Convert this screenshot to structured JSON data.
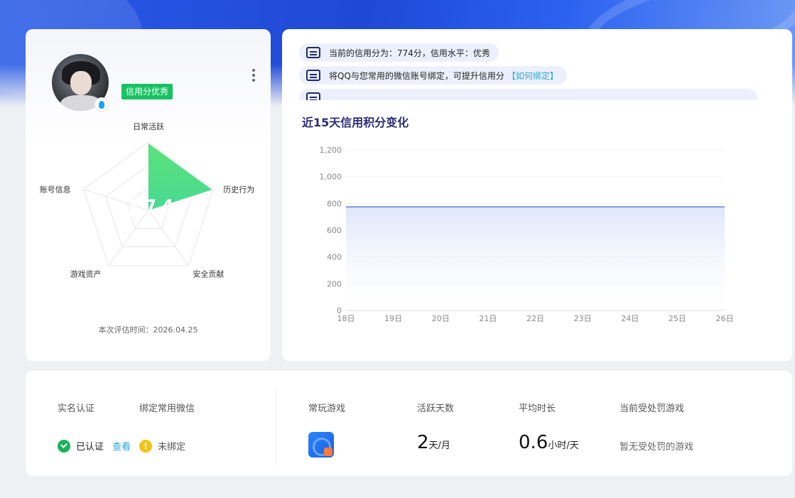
{
  "profile": {
    "credit_badge": "信用分优秀",
    "score": "774",
    "eval_time": "本次评估时间：2026.04.25",
    "radar_axes": [
      "日常活跃",
      "历史行为",
      "安全贡献",
      "游戏资产",
      "账号信息"
    ],
    "radar_values": [
      0.98,
      0.98,
      0.0,
      0.98,
      0.0
    ],
    "radar_fill_color": "#3fdc8a"
  },
  "tips": [
    {
      "text": "当前的信用分为：774分，信用水平：优秀",
      "link": ""
    },
    {
      "text": "将QQ与您常用的微信账号绑定，可提升信用分",
      "link": "【如何绑定】"
    }
  ],
  "chart_title": "近15天信用积分变化",
  "chart_data": {
    "type": "area",
    "x": [
      "18日",
      "19日",
      "20日",
      "21日",
      "22日",
      "23日",
      "24日",
      "25日",
      "26日"
    ],
    "series": [
      {
        "values": [
          774,
          774,
          774,
          774,
          774,
          774,
          774,
          774,
          774
        ]
      }
    ],
    "yticks": [
      "0",
      "200",
      "400",
      "600",
      "800",
      "1,000",
      "1,200"
    ],
    "ylim": [
      0,
      1200
    ],
    "grid": true,
    "line_color": "#7a9ad8",
    "fill_color": "#dfe6fb"
  },
  "info": {
    "realname_label": "实名认证",
    "wechat_label": "绑定常用微信",
    "realname_status": "已认证",
    "view_link": "查看",
    "wechat_status": "未绑定",
    "games_label": "常玩游戏",
    "active_days_label": "活跃天数",
    "avg_time_label": "平均时长",
    "punish_label": "当前受处罚游戏",
    "active_days_value": "2",
    "active_days_unit": "天/月",
    "avg_time_value": "0.6",
    "avg_time_unit": "小时/天",
    "punish_text": "暂无受处罚的游戏"
  }
}
